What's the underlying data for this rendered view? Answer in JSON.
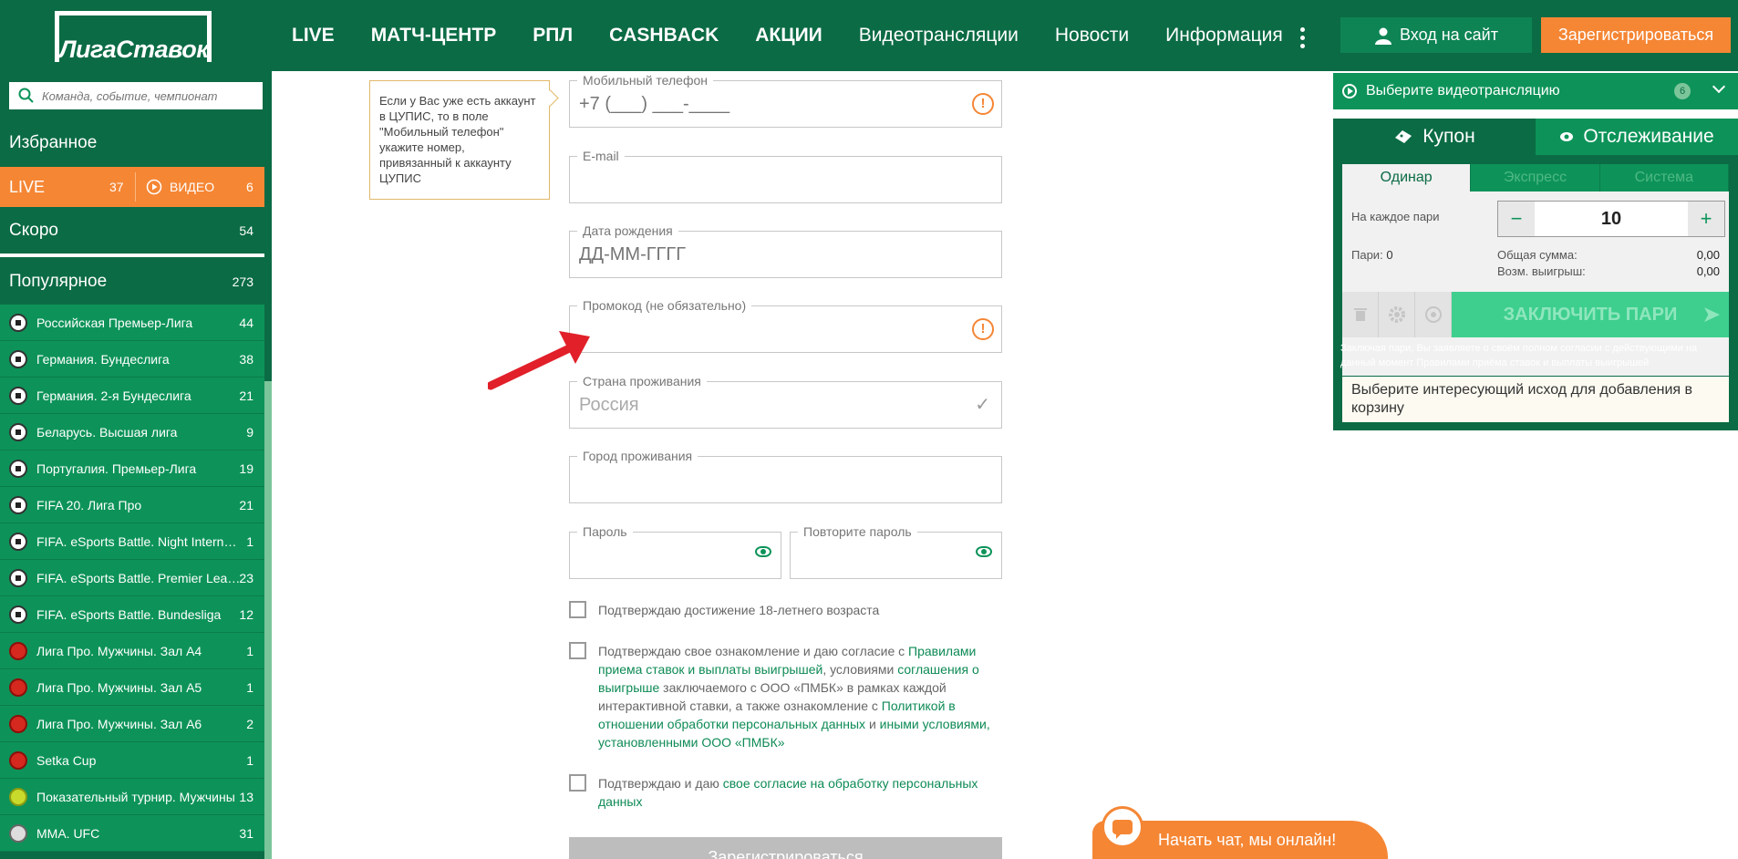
{
  "header": {
    "logo": "ЛигаСтавок",
    "nav": [
      {
        "label": "LIVE",
        "bold": true
      },
      {
        "label": "МАТЧ-ЦЕНТР",
        "bold": true
      },
      {
        "label": "РПЛ",
        "bold": true
      },
      {
        "label": "CASHBACK",
        "bold": true
      },
      {
        "label": "АКЦИИ",
        "bold": true
      },
      {
        "label": "Видеотрансляции",
        "bold": false
      },
      {
        "label": "Новости",
        "bold": false
      },
      {
        "label": "Информация",
        "bold": false
      }
    ],
    "login": "Вход на сайт",
    "register": "Зарегистрироваться"
  },
  "sidebar": {
    "search_placeholder": "Команда, событие, чемпионат",
    "favorites": "Избранное",
    "live": {
      "label": "LIVE",
      "count": "37",
      "video_label": "ВИДЕО",
      "video_count": "6"
    },
    "soon": {
      "label": "Скоро",
      "count": "54"
    },
    "popular": {
      "label": "Популярное",
      "count": "273"
    },
    "leagues": [
      {
        "name": "Российская Премьер-Лига",
        "count": "44",
        "sport": "football"
      },
      {
        "name": "Германия. Бундеслига",
        "count": "38",
        "sport": "football"
      },
      {
        "name": "Германия. 2-я Бундеслига",
        "count": "21",
        "sport": "football"
      },
      {
        "name": "Беларусь. Высшая лига",
        "count": "9",
        "sport": "football"
      },
      {
        "name": "Португалия. Премьер-Лига",
        "count": "19",
        "sport": "football"
      },
      {
        "name": "FIFA 20. Лига Про",
        "count": "21",
        "sport": "football"
      },
      {
        "name": "FIFA. eSports Battle. Night Internati...",
        "count": "1",
        "sport": "football"
      },
      {
        "name": "FIFA. eSports Battle. Premier League",
        "count": "23",
        "sport": "football"
      },
      {
        "name": "FIFA. eSports Battle. Bundesliga",
        "count": "12",
        "sport": "football"
      },
      {
        "name": "Лига Про. Мужчины. Зал А4",
        "count": "1",
        "sport": "pingpong"
      },
      {
        "name": "Лига Про. Мужчины. Зал А5",
        "count": "1",
        "sport": "pingpong"
      },
      {
        "name": "Лига Про. Мужчины. Зал А6",
        "count": "2",
        "sport": "pingpong"
      },
      {
        "name": "Setka Cup",
        "count": "1",
        "sport": "pingpong"
      },
      {
        "name": "Показательный турнир. Мужчины",
        "count": "13",
        "sport": "tennis"
      },
      {
        "name": "MMA. UFC",
        "count": "31",
        "sport": "mma"
      }
    ]
  },
  "form": {
    "tooltip": "Если у Вас уже есть аккаунт в ЦУПИС, то в поле \"Мобильный телефон\" укажите номер, привязанный к аккаунту ЦУПИС",
    "phone_label": "Мобильный телефон",
    "phone_placeholder": "+7 (___) ___-____",
    "email_label": "E-mail",
    "birth_label": "Дата рождения",
    "birth_placeholder": "ДД-ММ-ГГГГ",
    "promo_label": "Промокод  (не обязательно)",
    "country_label": "Страна проживания",
    "country_value": "Россия",
    "city_label": "Город проживания",
    "password_label": "Пароль",
    "password_repeat_label": "Повторите пароль",
    "check_age": "Подтверждаю достижение 18-летнего возраста",
    "check_rules": {
      "t1": "Подтверждаю свое ознакомление и даю согласие с ",
      "l1": "Правилами приема ставок и выплаты выигрышей",
      "t2": ", условиями ",
      "l2": "соглашения о выигрыше",
      "t3": " заключаемого с ООО «ПМБК» в рамках каждой интерактивной ставки, а также ознакомление с ",
      "l3": "Политикой в отношении обработки персональных данных",
      "t4": " и ",
      "l4": "иными условиями, установленными ООО «ПМБК»"
    },
    "check_data": {
      "t1": "Подтверждаю и даю ",
      "l1": "свое согласие на обработку персональных данных"
    },
    "submit": "Зарегистрироваться"
  },
  "right": {
    "video_label": "Выберите видеотрансляцию",
    "video_count": "6",
    "coupon_tab": "Купон",
    "track_tab": "Отслеживание",
    "bet_tabs": [
      "Одинар",
      "Экспресс",
      "Система"
    ],
    "stake_label": "На каждое пари",
    "stake_value": "10",
    "bets_label": "Пари:",
    "bets_value": "0",
    "total_label": "Общая сумма:",
    "total_value": "0,00",
    "win_label": "Возм. выигрыш:",
    "win_value": "0,00",
    "place_bet": "ЗАКЛЮЧИТЬ ПАРИ",
    "note_text": "Заключая пари, Вы заявляете о своём полном согласии с действующими на данный момент ",
    "note_link": "Правилами приёма ставок и выплаты выигрышей",
    "hint": "Выберите интересующий исход для добавления в корзину"
  },
  "chat": {
    "label": "Начать чат, мы онлайн!"
  }
}
